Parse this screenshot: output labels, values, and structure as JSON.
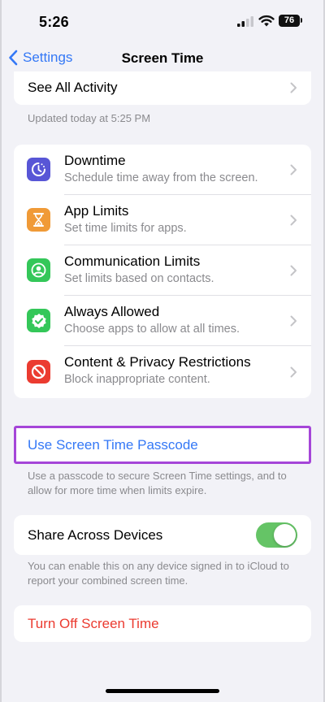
{
  "status_bar": {
    "time": "5:26",
    "battery": "76"
  },
  "nav": {
    "back_label": "Settings",
    "title": "Screen Time"
  },
  "activity": {
    "label": "See All Activity",
    "updated": "Updated today at 5:25 PM"
  },
  "limits": [
    {
      "title": "Downtime",
      "subtitle": "Schedule time away from the screen.",
      "icon": "downtime-icon",
      "color": "#5856d6"
    },
    {
      "title": "App Limits",
      "subtitle": "Set time limits for apps.",
      "icon": "hourglass-icon",
      "color": "#f09a37"
    },
    {
      "title": "Communication Limits",
      "subtitle": "Set limits based on contacts.",
      "icon": "contact-icon",
      "color": "#34c759"
    },
    {
      "title": "Always Allowed",
      "subtitle": "Choose apps to allow at all times.",
      "icon": "checkmark-seal-icon",
      "color": "#34c759"
    },
    {
      "title": "Content & Privacy Restrictions",
      "subtitle": "Block inappropriate content.",
      "icon": "restriction-icon",
      "color": "#eb3b30"
    }
  ],
  "passcode": {
    "label": "Use Screen Time Passcode",
    "footnote": "Use a passcode to secure Screen Time settings, and to allow for more time when limits expire."
  },
  "share": {
    "label": "Share Across Devices",
    "enabled": true,
    "footnote": "You can enable this on any device signed in to iCloud to report your combined screen time."
  },
  "turn_off": {
    "label": "Turn Off Screen Time"
  },
  "colors": {
    "accent": "#3478f6",
    "destructive": "#eb3b30",
    "toggle_on": "#65c466",
    "highlight": "#a545d8"
  }
}
